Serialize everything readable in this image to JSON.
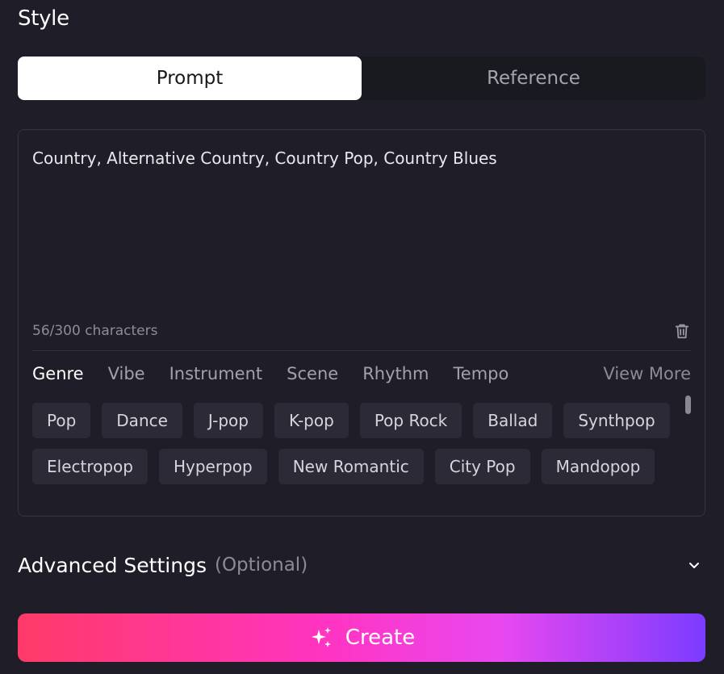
{
  "section_title": "Style",
  "mode_tabs": [
    {
      "label": "Prompt",
      "active": true
    },
    {
      "label": "Reference",
      "active": false
    }
  ],
  "prompt": {
    "value": "Country, Alternative Country, Country Pop, Country Blues",
    "char_count": "56/300 characters"
  },
  "category_tabs": [
    {
      "label": "Genre",
      "active": true
    },
    {
      "label": "Vibe"
    },
    {
      "label": "Instrument"
    },
    {
      "label": "Scene"
    },
    {
      "label": "Rhythm"
    },
    {
      "label": "Tempo"
    }
  ],
  "view_more": "View More",
  "chips": [
    "Pop",
    "Dance",
    "J-pop",
    "K-pop",
    "Pop Rock",
    "Ballad",
    "Synthpop",
    "Electropop",
    "Hyperpop",
    "New Romantic",
    "City Pop",
    "Mandopop"
  ],
  "advanced": {
    "title": "Advanced Settings",
    "optional": "(Optional)"
  },
  "create_label": "Create",
  "icons": {
    "delete": "trash-icon",
    "expand": "chevron-down-icon",
    "create": "sparkle-icon"
  },
  "colors": {
    "background": "#1f1e28",
    "chip": "#2b2a36",
    "gradient_start": "#ff3a68",
    "gradient_mid": "#ff34c2",
    "gradient_end": "#7c3cff"
  }
}
